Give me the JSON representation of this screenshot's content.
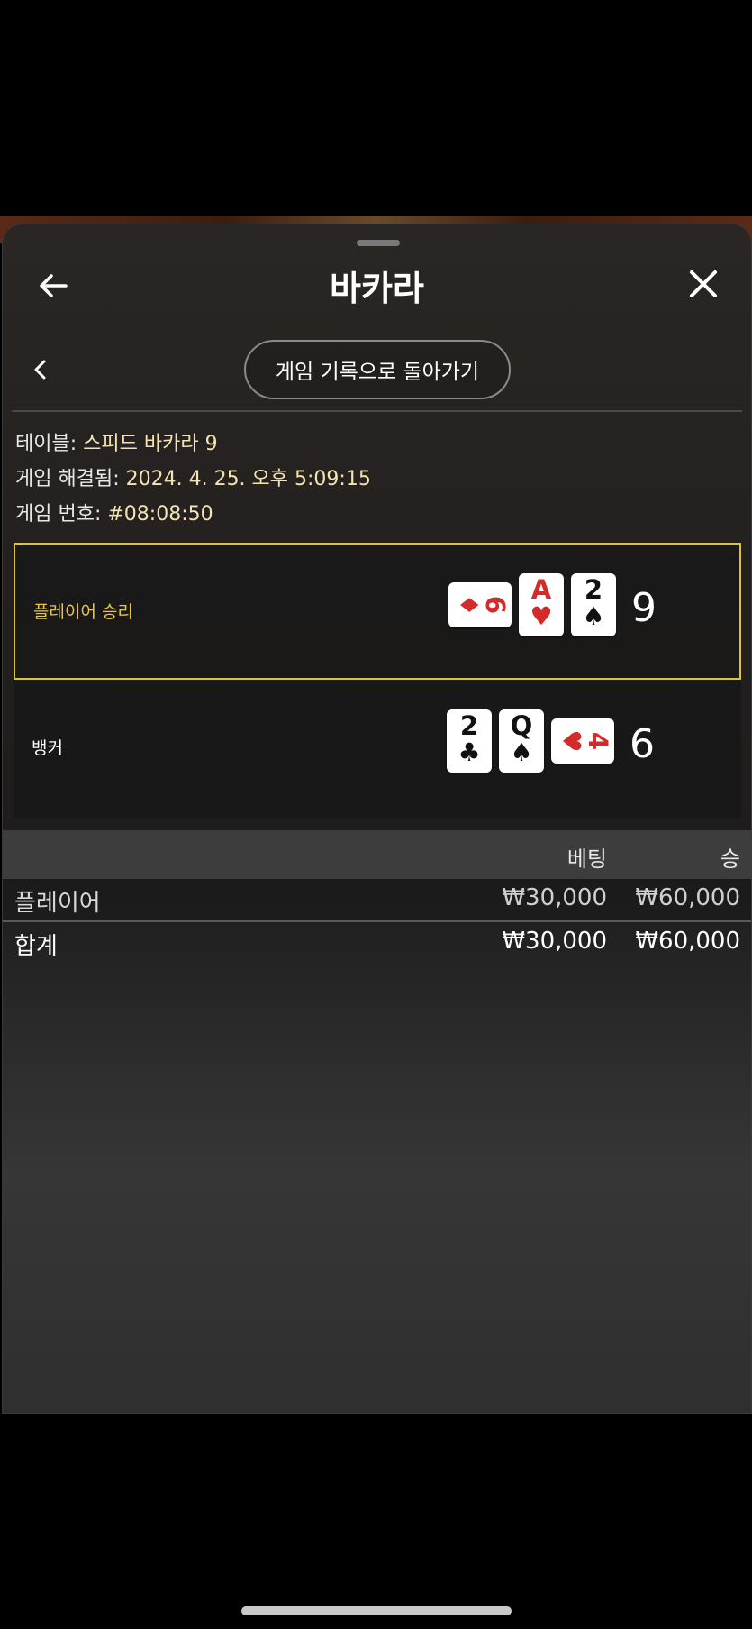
{
  "header": {
    "title": "바카라"
  },
  "nav": {
    "back_to_history": "게임 기록으로 돌아가기"
  },
  "info": {
    "table_label": "테이블:",
    "table_value": "스피드 바카라 9",
    "resolved_label": "게임 해결됨:",
    "resolved_value": "2024. 4. 25. 오후 5:09:15",
    "game_number_label": "게임 번호:",
    "game_number_value": "#08:08:50"
  },
  "results": [
    {
      "label": "플레이어 승리",
      "winner": true,
      "score": "9",
      "cards": [
        {
          "rank": "6",
          "suit": "♦",
          "color": "red",
          "orientation": "horizontal"
        },
        {
          "rank": "A",
          "suit": "♥",
          "color": "red",
          "orientation": "vertical"
        },
        {
          "rank": "2",
          "suit": "♠",
          "color": "black",
          "orientation": "vertical"
        }
      ]
    },
    {
      "label": "뱅커",
      "winner": false,
      "score": "6",
      "cards": [
        {
          "rank": "2",
          "suit": "♣",
          "color": "black",
          "orientation": "vertical"
        },
        {
          "rank": "Q",
          "suit": "♠",
          "color": "black",
          "orientation": "vertical"
        },
        {
          "rank": "4",
          "suit": "♥",
          "color": "red",
          "orientation": "horizontal"
        }
      ]
    }
  ],
  "bets_table": {
    "headers": {
      "bet": "베팅",
      "win": "승"
    },
    "rows": [
      {
        "name": "플레이어",
        "bet": "₩30,000",
        "win": "₩60,000"
      }
    ],
    "total": {
      "name": "합계",
      "bet": "₩30,000",
      "win": "₩60,000"
    }
  },
  "colors": {
    "win_border": "#d8c04a",
    "win_label": "#e8c73a",
    "info_value": "#f3e4b2"
  }
}
